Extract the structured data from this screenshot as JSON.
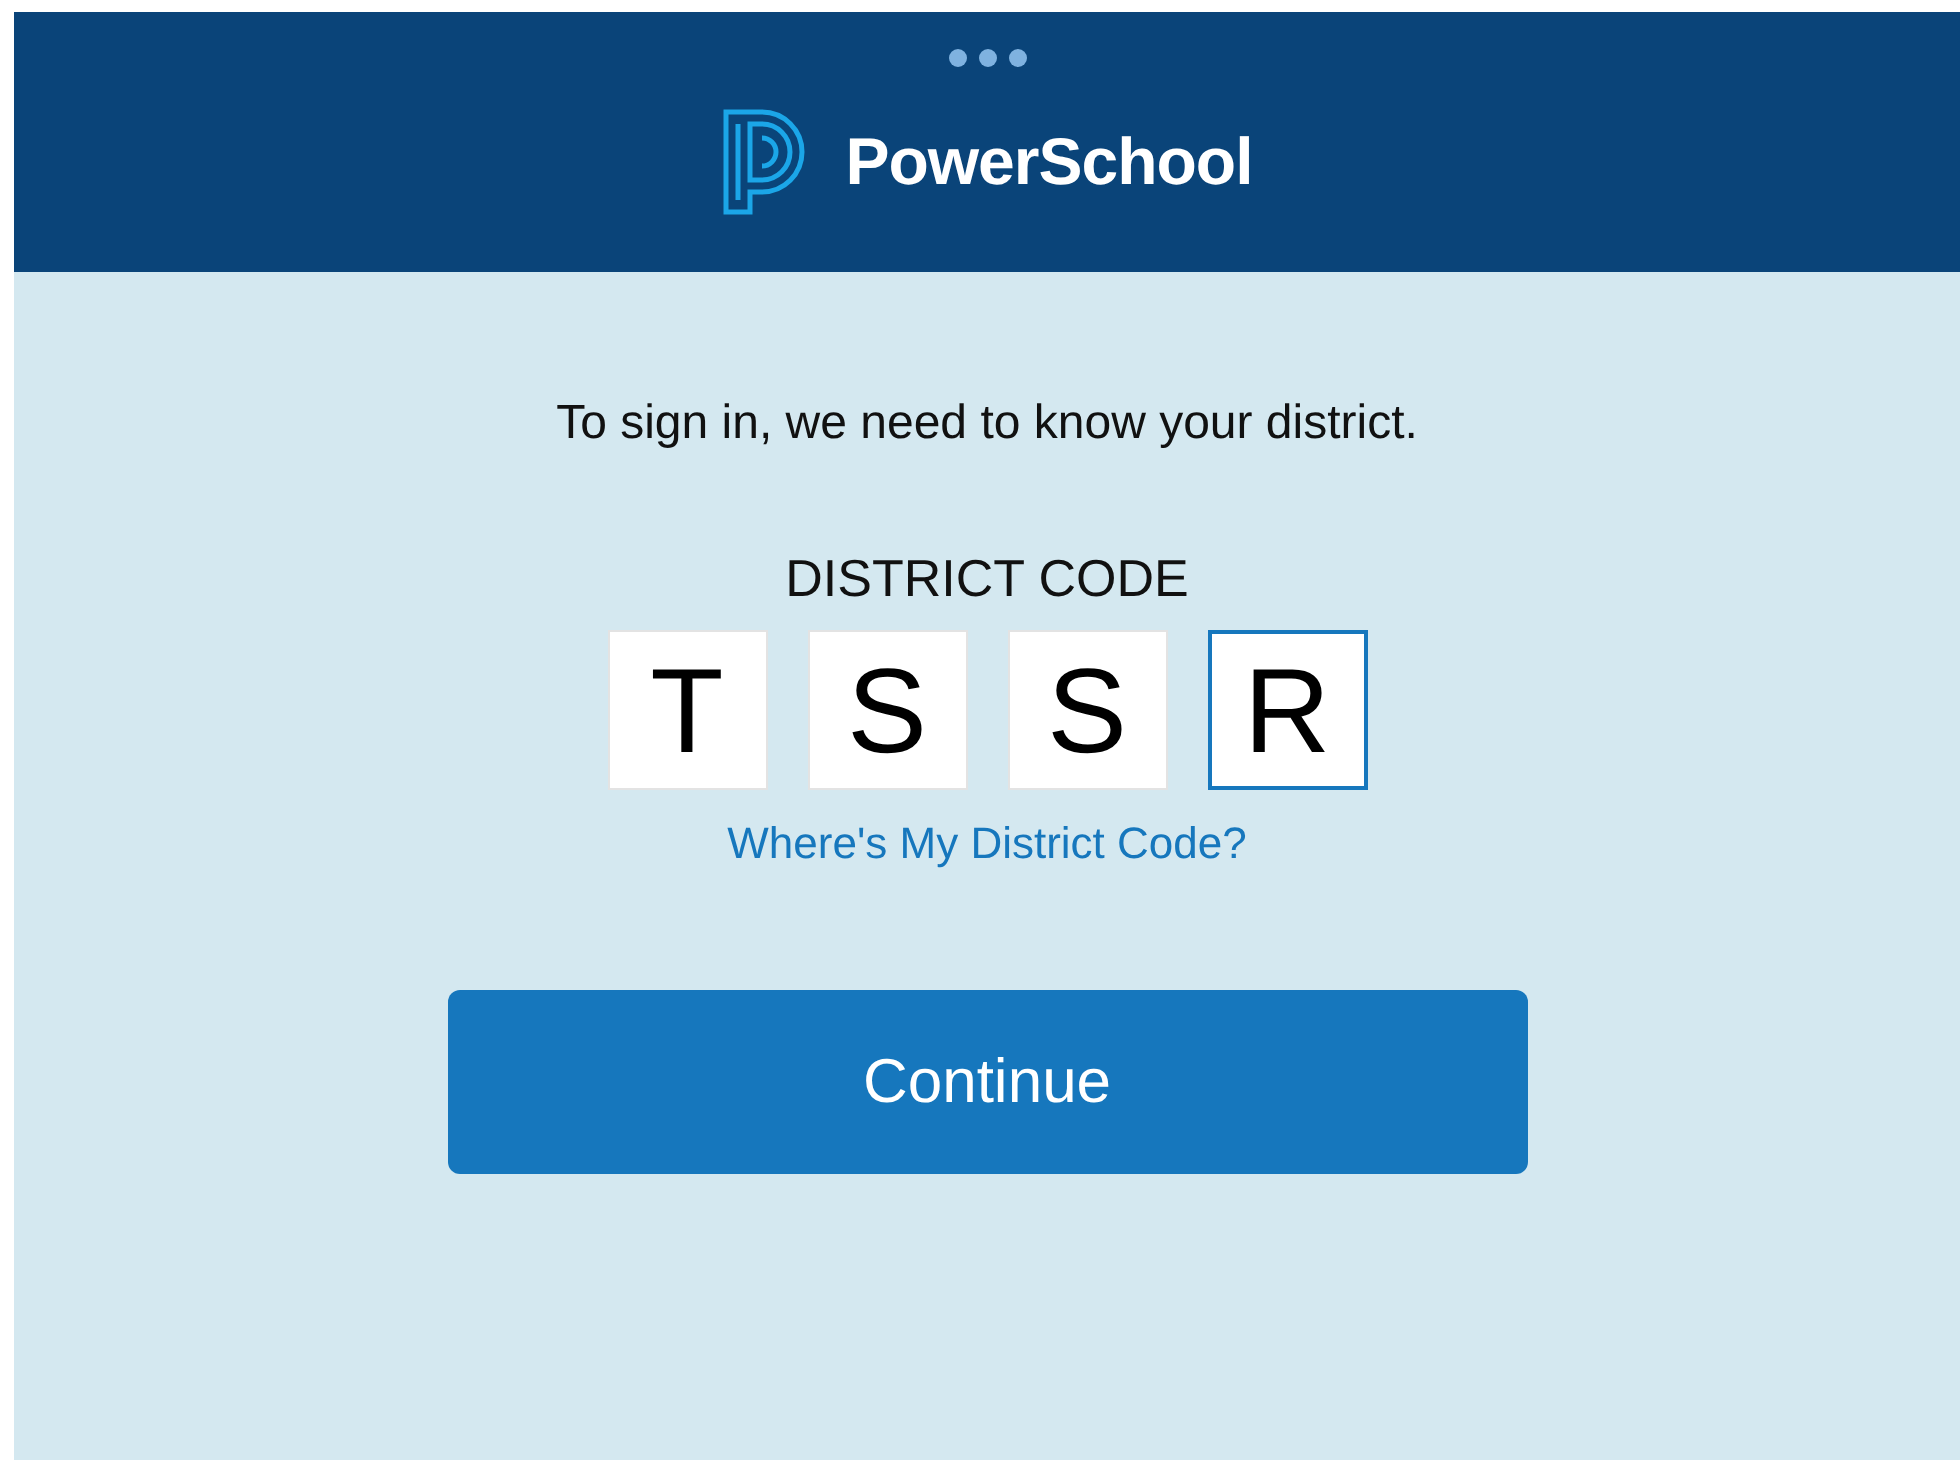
{
  "header": {
    "brand": "PowerSchool"
  },
  "prompt": "To sign in, we need to know your district.",
  "district_code": {
    "label": "DISTRICT CODE",
    "boxes": [
      {
        "value": "T",
        "selected": false
      },
      {
        "value": "S",
        "selected": false
      },
      {
        "value": "S",
        "selected": false
      },
      {
        "value": "R",
        "selected": true
      }
    ],
    "help_link": "Where's My District Code?"
  },
  "continue_button": "Continue"
}
